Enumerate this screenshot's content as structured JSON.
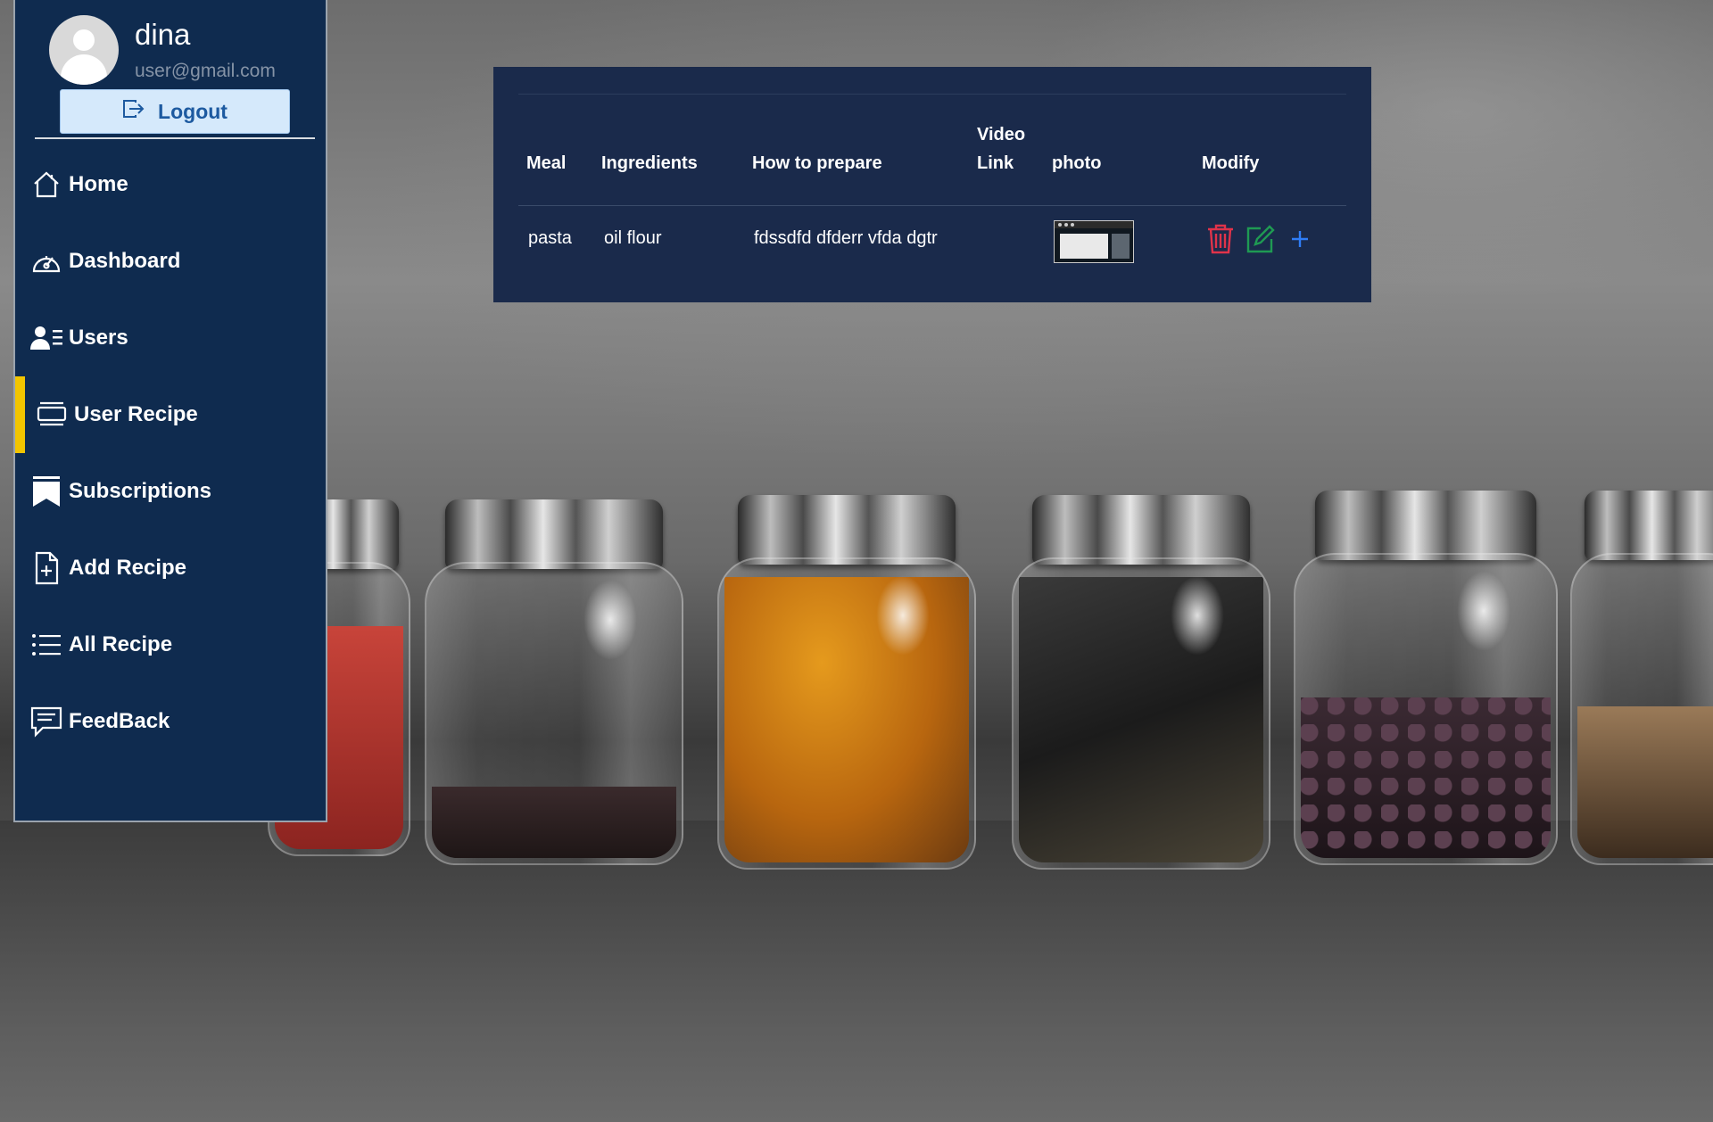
{
  "user": {
    "name": "dina",
    "email": "user@gmail.com",
    "logout_label": "Logout"
  },
  "sidebar": {
    "items": [
      {
        "label": "Home",
        "icon": "house-icon"
      },
      {
        "label": "Dashboard",
        "icon": "speedometer-icon"
      },
      {
        "label": "Users",
        "icon": "user-list-icon"
      },
      {
        "label": "User Recipe",
        "icon": "card-stack-icon",
        "active": true
      },
      {
        "label": "Subscriptions",
        "icon": "bookmarks-icon"
      },
      {
        "label": "Add Recipe",
        "icon": "file-plus-icon"
      },
      {
        "label": "All Recipe",
        "icon": "list-icon"
      },
      {
        "label": "FeedBack",
        "icon": "chat-text-icon"
      }
    ]
  },
  "table": {
    "headers": {
      "meal": "Meal",
      "ingredients": "Ingredients",
      "how_to": "How to prepare",
      "video_1": "Video",
      "video_2": "Link",
      "photo": "photo",
      "modify": "Modify"
    },
    "rows": [
      {
        "meal": "pasta",
        "ingredients": "oil flour",
        "how_to": "fdssdfd dfderr vfda dgtr",
        "video_link": "",
        "photo": "screenshot-thumbnail"
      }
    ],
    "actions": {
      "delete_icon": "trash-icon",
      "edit_icon": "edit-icon",
      "add_icon": "plus-icon"
    }
  },
  "colors": {
    "sidebar_bg": "#0f2b4f",
    "card_bg": "#1a2a4b",
    "active_marker": "#f2c500",
    "delete": "#e0334a",
    "edit": "#1f9a53",
    "add": "#2f7df6",
    "logout_bg": "#d5e9fb",
    "logout_text": "#1d5aa0"
  }
}
